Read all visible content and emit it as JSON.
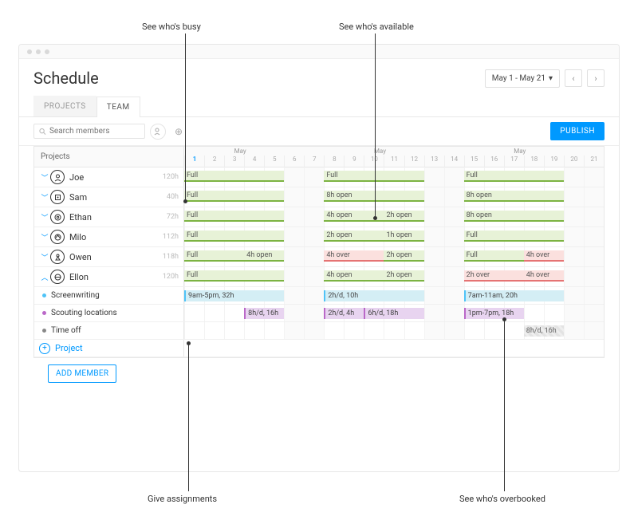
{
  "annotations": {
    "busy": "See who's busy",
    "available": "See who's available",
    "assignments": "Give assignments",
    "overbooked": "See who's overbooked"
  },
  "header": {
    "title": "Schedule",
    "date_range": "May 1 - May 21"
  },
  "tabs": {
    "projects": "PROJECTS",
    "team": "TEAM"
  },
  "toolbar": {
    "search_placeholder": "Search members",
    "publish": "PUBLISH"
  },
  "grid": {
    "left_header": "Projects",
    "month_label": "May",
    "days": [
      1,
      2,
      3,
      4,
      5,
      6,
      7,
      8,
      9,
      10,
      11,
      12,
      13,
      14,
      15,
      16,
      17,
      18,
      19,
      20,
      21
    ],
    "weekends": [
      6,
      7,
      13,
      14,
      20,
      21
    ]
  },
  "members": [
    {
      "name": "Joe",
      "hours": "120h",
      "bars": [
        [
          "Full",
          "full",
          1,
          5
        ],
        [
          "Full",
          "full",
          8,
          12
        ],
        [
          "Full",
          "full",
          15,
          19
        ]
      ]
    },
    {
      "name": "Sam",
      "hours": "40h",
      "bars": [
        [
          "Full",
          "full",
          1,
          5
        ],
        [
          "8h open",
          "open",
          8,
          12
        ],
        [
          "8h open",
          "open",
          15,
          19
        ]
      ]
    },
    {
      "name": "Ethan",
      "hours": "72h",
      "bars": [
        [
          "Full",
          "full",
          1,
          5
        ],
        [
          "4h open",
          "open",
          8,
          10
        ],
        [
          "2h open",
          "open",
          11,
          12
        ],
        [
          "8h open",
          "open",
          15,
          19
        ]
      ]
    },
    {
      "name": "Milo",
      "hours": "112h",
      "bars": [
        [
          "Full",
          "full",
          1,
          5
        ],
        [
          "2h open",
          "open",
          8,
          10
        ],
        [
          "1h open",
          "open",
          11,
          12
        ],
        [
          "Full",
          "full",
          15,
          19
        ]
      ]
    },
    {
      "name": "Owen",
      "hours": "118h",
      "bars": [
        [
          "Full",
          "full",
          1,
          3
        ],
        [
          "4h open",
          "open",
          4,
          5
        ],
        [
          "4h over",
          "over",
          8,
          10
        ],
        [
          "2h open",
          "open",
          11,
          12
        ],
        [
          "Full",
          "full",
          15,
          17
        ],
        [
          "4h over",
          "over",
          18,
          19
        ]
      ]
    },
    {
      "name": "Ellon",
      "hours": "120h",
      "bars": [
        [
          "Full",
          "full",
          1,
          5
        ],
        [
          "4h open",
          "open",
          8,
          10
        ],
        [
          "2h open",
          "open",
          11,
          12
        ],
        [
          "2h over",
          "over",
          15,
          17
        ],
        [
          "4h over",
          "over",
          18,
          19
        ]
      ],
      "expanded": true
    }
  ],
  "tasks": [
    {
      "name": "Screenwriting",
      "color": "#4fc3f7",
      "bars": [
        [
          "9am-5pm, 32h",
          "task-blue",
          1,
          5
        ],
        [
          "2h/d, 10h",
          "task-blue",
          8,
          12
        ],
        [
          "7am-11am, 20h",
          "task-blue",
          15,
          19
        ]
      ]
    },
    {
      "name": "Scouting locations",
      "color": "#ba68c8",
      "bars": [
        [
          "8h/d, 16h",
          "task-purple",
          4,
          5
        ],
        [
          "2h/d, 4h",
          "task-purple",
          8,
          9
        ],
        [
          "6h/d, 18h",
          "task-purple",
          10,
          12
        ],
        [
          "1pm-7pm, 18h",
          "task-purple",
          15,
          17
        ]
      ]
    },
    {
      "name": "Time off",
      "color": "#888",
      "bars": [
        [
          "8h/d, 16h",
          "task-grey",
          18,
          19
        ]
      ]
    }
  ],
  "footer": {
    "add_project": "Project",
    "add_member": "ADD MEMBER"
  }
}
